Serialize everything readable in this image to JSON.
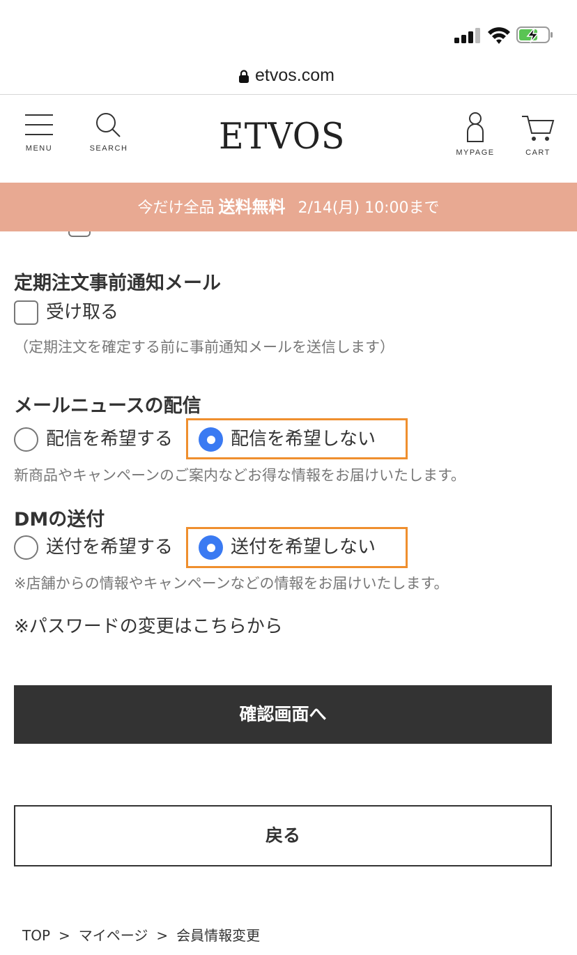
{
  "browser": {
    "url": "etvos.com"
  },
  "header": {
    "logo": "ETVOS",
    "menu_label": "MENU",
    "search_label": "SEARCH",
    "mypage_label": "MYPAGE",
    "cart_label": "CART"
  },
  "promo": {
    "prefix": "今だけ全品",
    "highlight": "送料無料",
    "suffix": "2/14(月) 10:00まで"
  },
  "form": {
    "subscription_notice": {
      "title": "定期注文事前通知メール",
      "option_label": "受け取る",
      "checked": false,
      "note": "（定期注文を確定する前に事前通知メールを送信します）"
    },
    "mail_news": {
      "title": "メールニュースの配信",
      "options": [
        {
          "label": "配信を希望する",
          "selected": false
        },
        {
          "label": "配信を希望しない",
          "selected": true
        }
      ],
      "note": "新商品やキャンペーンのご案内などお得な情報をお届けいたします。"
    },
    "dm": {
      "title": "DMの送付",
      "options": [
        {
          "label": "送付を希望する",
          "selected": false
        },
        {
          "label": "送付を希望しない",
          "selected": true
        }
      ],
      "note": "※店舗からの情報やキャンペーンなどの情報をお届けいたします。"
    },
    "password_link": "※パスワードの変更はこちらから",
    "confirm_button": "確認画面へ",
    "back_button": "戻る"
  },
  "breadcrumb": {
    "items": [
      "TOP",
      "マイページ",
      "会員情報変更"
    ],
    "separator": ">"
  },
  "colors": {
    "promo_bg": "#e8a992",
    "radio_selected": "#3a7af2",
    "highlight_border": "#ef8f2e",
    "primary_button_bg": "#333333"
  },
  "icons": {
    "menu": "hamburger-icon",
    "search": "magnifier-icon",
    "mypage": "person-icon",
    "cart": "cart-icon",
    "lock": "lock-icon"
  }
}
